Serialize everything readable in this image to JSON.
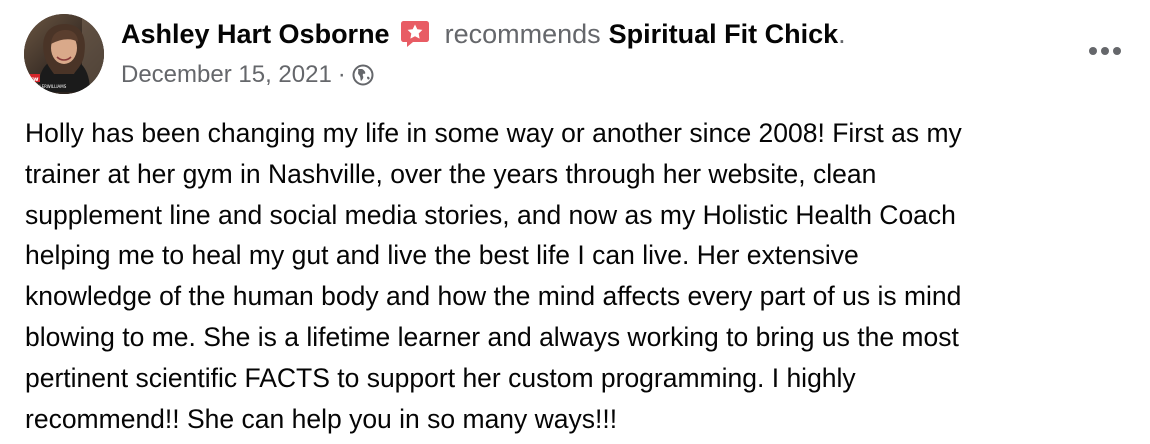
{
  "post": {
    "author": {
      "name": "Ashley Hart Osborne",
      "avatar_alt": "Ashley Hart Osborne profile photo"
    },
    "recommend_badge_icon": "recommend-star-icon",
    "recommends_text": "recommends",
    "page_name": "Spiritual Fit Chick",
    "trailing_period": ".",
    "date": "December 15, 2021",
    "separator": "·",
    "audience_icon": "globe-icon",
    "more_icon": "more-options-icon",
    "body_text": "Holly has been changing my life in some way or another since 2008! First as my\ntrainer at her gym in Nashville, over the years through her website, clean\nsupplement line and social media stories, and now as my Holistic Health Coach\nhelping me to heal my gut and live the best life I can live. Her extensive\nknowledge of the human body and how the mind affects every part of us is mind\nblowing to me. She is a lifetime learner and always working to bring us the most\npertinent scientific FACTS to support her custom programming. I highly\nrecommend!! She can help you in so many ways!!!"
  },
  "colors": {
    "primary_text": "#050505",
    "secondary_text": "#65676b",
    "badge_red": "#e85c64",
    "background": "#ffffff"
  }
}
